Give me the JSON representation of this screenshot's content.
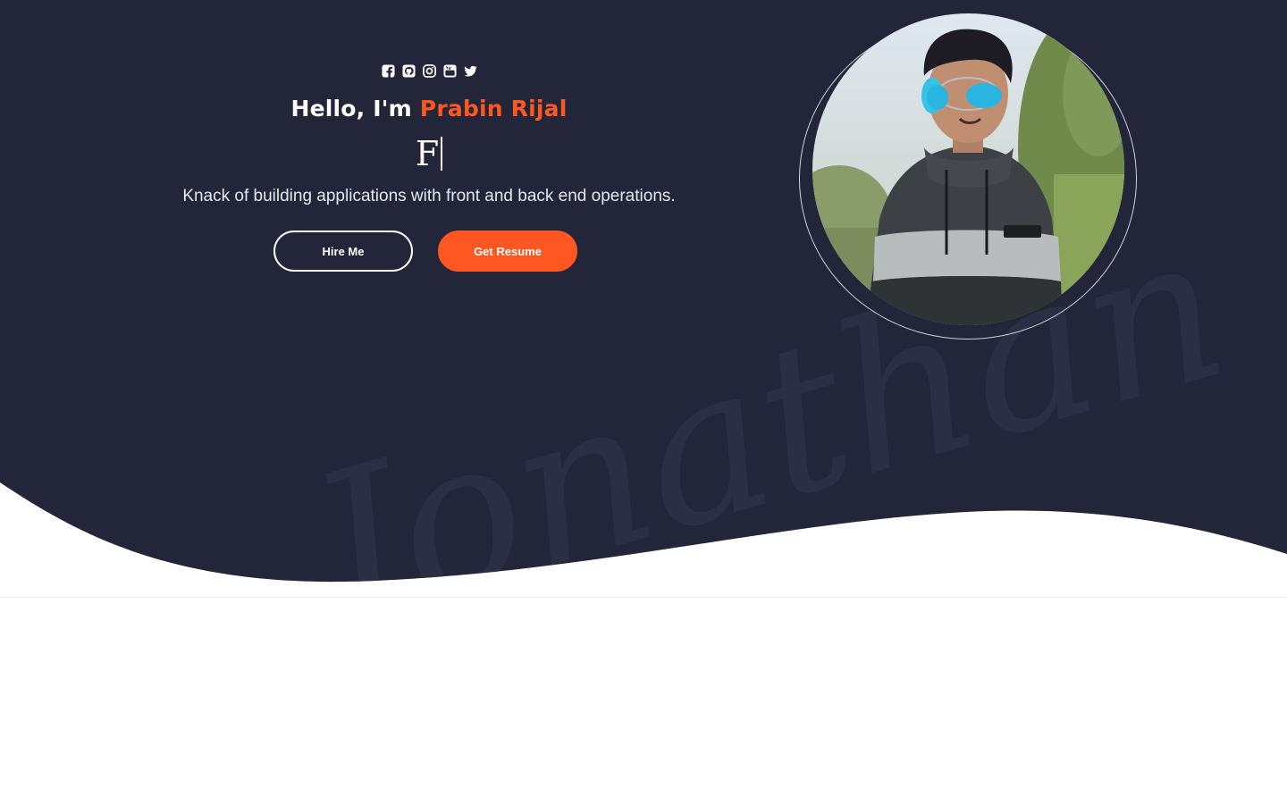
{
  "colors": {
    "hero_bg": "#232539",
    "accent": "#ff5722",
    "text": "#ffffff",
    "watermark": "#2c2f44"
  },
  "social_icons": [
    "facebook-icon",
    "github-icon",
    "instagram-icon",
    "youtube-icon",
    "twitter-icon"
  ],
  "hero": {
    "greeting_prefix": "Hello, I'm ",
    "name": "Prabin Rijal",
    "typed_text": "F",
    "tagline": "Knack of building applications with front and back end operations.",
    "watermark_text": "Jonathan"
  },
  "buttons": {
    "hire_label": "Hire Me",
    "resume_label": "Get Resume"
  }
}
